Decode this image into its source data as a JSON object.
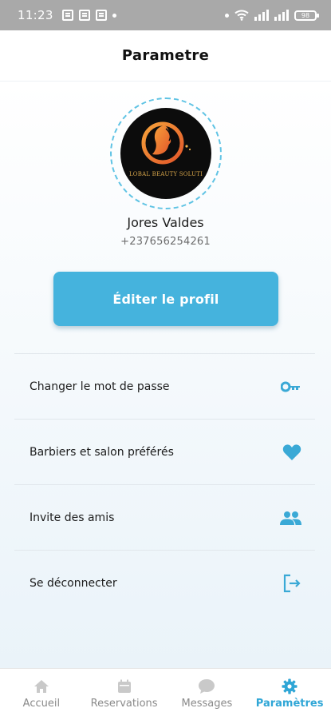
{
  "status_bar": {
    "time": "11:23",
    "battery_label": "98"
  },
  "header": {
    "title": "Parametre"
  },
  "profile": {
    "logo_text": "LOBAL BEAUTY SOLUTI",
    "name": "Jores Valdes",
    "phone": "+237656254261",
    "edit_button_label": "Éditer le profil"
  },
  "menu": {
    "items": [
      {
        "label": "Changer le mot de passe",
        "icon": "key-icon"
      },
      {
        "label": "Barbiers et salon préférés",
        "icon": "heart-icon"
      },
      {
        "label": "Invite des amis",
        "icon": "people-icon"
      },
      {
        "label": "Se déconnecter",
        "icon": "logout-icon"
      }
    ]
  },
  "bottom_nav": {
    "items": [
      {
        "label": "Accueil",
        "icon": "home-icon",
        "active": false
      },
      {
        "label": "Reservations",
        "icon": "calendar-icon",
        "active": false
      },
      {
        "label": "Messages",
        "icon": "chat-bubble-icon",
        "active": false
      },
      {
        "label": "Paramètres",
        "icon": "gear-icon",
        "active": true
      }
    ]
  },
  "colors": {
    "accent": "#45b3dd",
    "active_nav": "#2fa6d6",
    "inactive_nav": "#8a8a8a",
    "status_bar": "#a9a9a9"
  }
}
